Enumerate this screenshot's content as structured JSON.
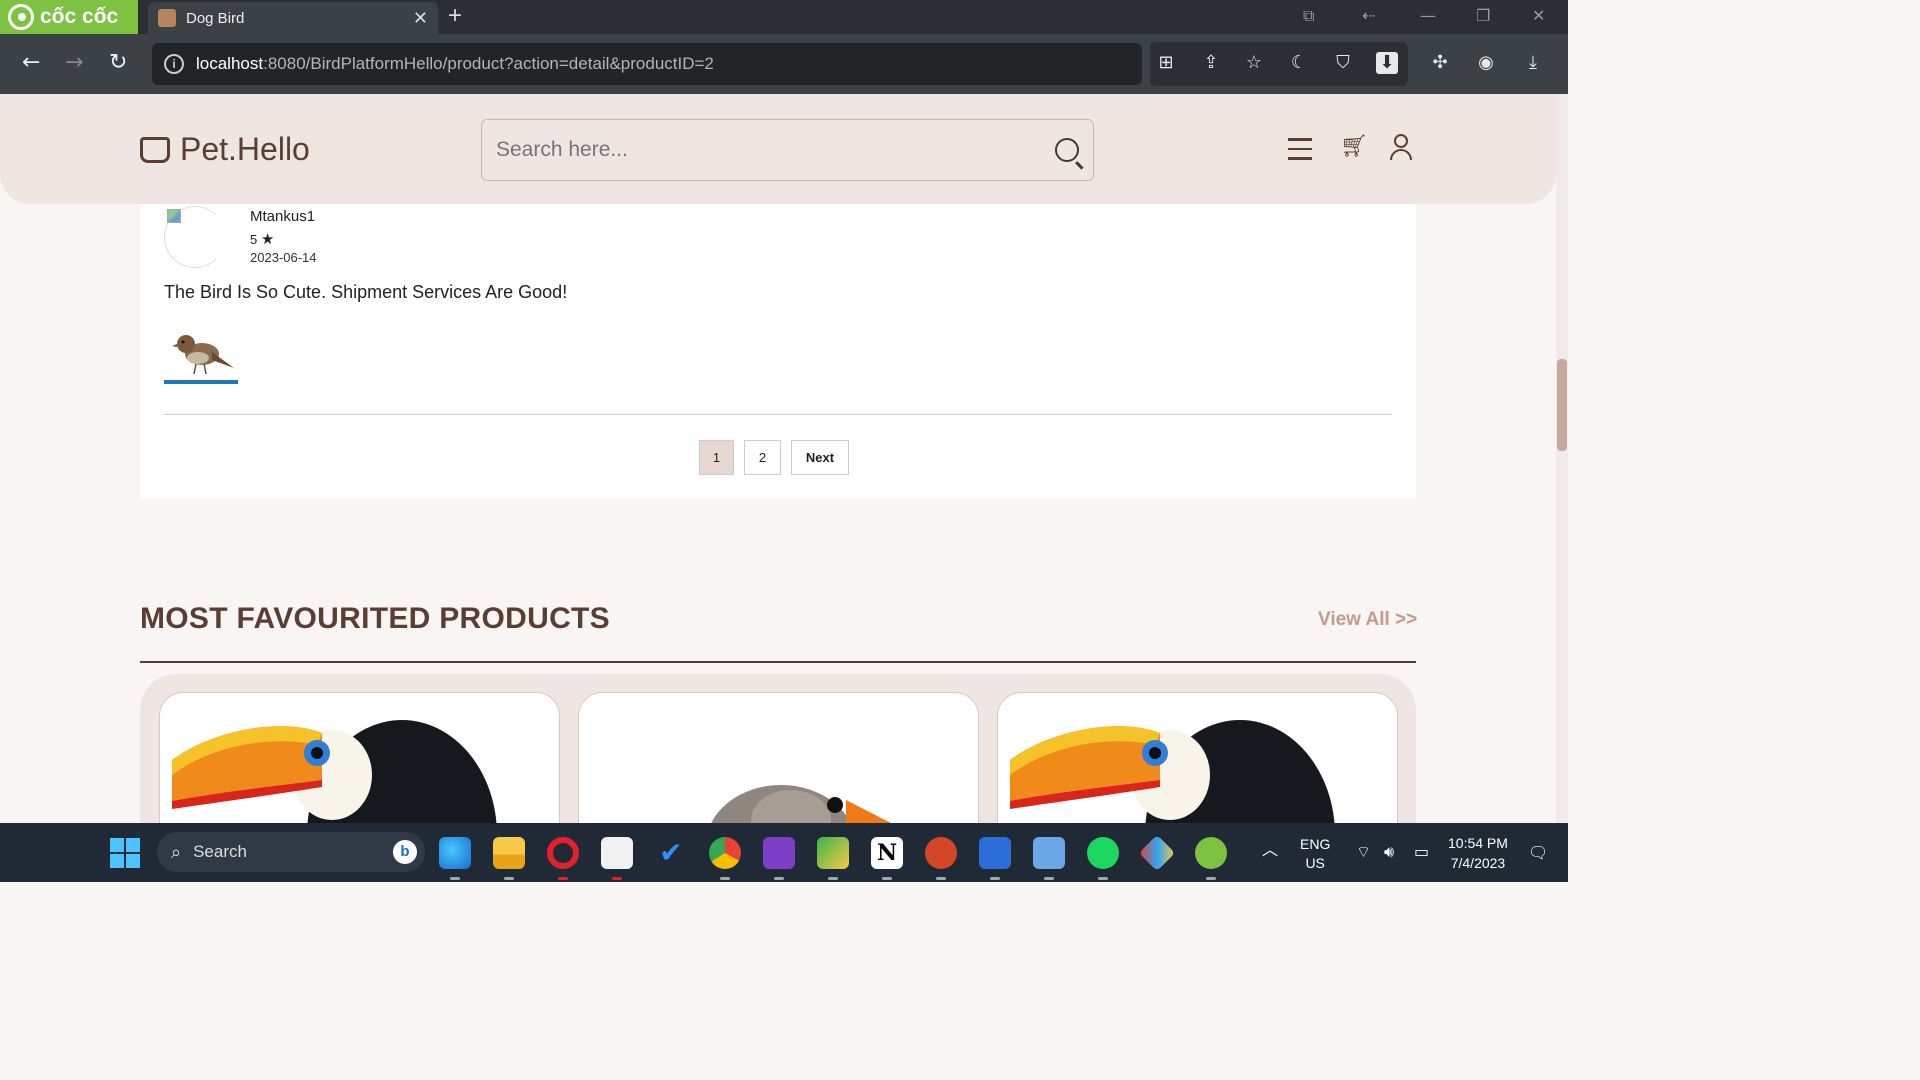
{
  "browser": {
    "brand": "cốc cốc",
    "tab_title": "Dog Bird",
    "url_host": "localhost",
    "url_rest": ":8080/BirdPlatformHello/product?action=detail&productID=2"
  },
  "site": {
    "logo_text": "Pet.Hello",
    "search_placeholder": "Search here..."
  },
  "review": {
    "username": "Mtankus1",
    "rating": "5",
    "date": "2023-06-14",
    "text": "The Bird Is So Cute. Shipment Services Are Good!"
  },
  "pagination": {
    "pages": [
      "1",
      "2"
    ],
    "next_label": "Next",
    "active_page": "1"
  },
  "favourites": {
    "title": "MOST FAVOURITED PRODUCTS",
    "view_all": "View All >>",
    "products": [
      {
        "image": "toucan"
      },
      {
        "image": "sparrow"
      },
      {
        "image": "toucan"
      }
    ]
  },
  "taskbar": {
    "search_label": "Search",
    "lang_line1": "ENG",
    "lang_line2": "US",
    "time": "10:54 PM",
    "date": "7/4/2023"
  },
  "colors": {
    "header_bg": "#efe6e2",
    "brand_brown": "#5a3e33",
    "accent_view_all": "#c69a8a",
    "active_page_bg": "#e8d6d0",
    "coccoc_green": "#7ec242"
  }
}
